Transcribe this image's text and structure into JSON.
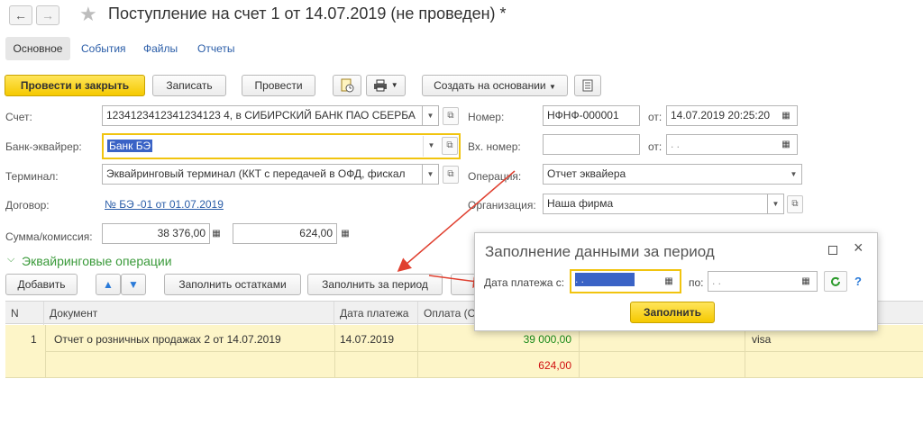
{
  "window": {
    "title": "Поступление на счет 1 от 14.07.2019 (не проведен) *"
  },
  "tabs": {
    "main": "Основное",
    "events": "События",
    "files": "Файлы",
    "reports": "Отчеты"
  },
  "toolbar": {
    "post_close": "Провести и закрыть",
    "save": "Записать",
    "post": "Провести",
    "create_based": "Создать на основании"
  },
  "form": {
    "account_label": "Счет:",
    "account_value": "1234123412341234123 4, в СИБИРСКИЙ БАНК ПАО СБЕРБА",
    "acquirer_label": "Банк-эквайрер:",
    "acquirer_value": "Банк БЭ",
    "terminal_label": "Терминал:",
    "terminal_value": "Эквайринговый терминал  (ККТ с передачей в ОФД, фискал",
    "contract_label": "Договор:",
    "contract_value": "№ БЭ -01 от 01.07.2019",
    "sum_label": "Сумма/комиссия:",
    "sum_value": "38 376,00",
    "commission_value": "624,00",
    "number_label": "Номер:",
    "number_value": "НФНФ-000001",
    "from_label": "от:",
    "date_value": "14.07.2019 20:25:20",
    "in_number_label": "Вх. номер:",
    "in_number_value": "",
    "in_date_value": " .  .",
    "operation_label": "Операция:",
    "operation_value": "Отчет эквайера",
    "org_label": "Организация:",
    "org_value": "Наша фирма"
  },
  "section": {
    "title": "Эквайринговые операции",
    "add": "Добавить",
    "fill_remains": "Заполнить остатками",
    "fill_period": "Заполнить за период"
  },
  "table": {
    "headers": [
      "N",
      "Документ",
      "Дата платежа",
      "Оплата (С"
    ],
    "rows": [
      {
        "n": "1",
        "document": "Отчет о розничных продажах 2 от 14.07.2019",
        "date": "14.07.2019",
        "payment": "39 000,00",
        "commission": "624,00",
        "card": "visa"
      }
    ]
  },
  "popup": {
    "title": "Заполнение данными за период",
    "date_from_label": "Дата платежа с:",
    "date_from_value": " .  .",
    "to_label": "по:",
    "date_to_value": " .  .",
    "fill_button": "Заполнить",
    "help": "?"
  },
  "colors": {
    "accent_yellow": "#f5c900",
    "link_blue": "#2a5da8",
    "section_green": "#3a9a3a",
    "row_yellow": "#fdf5c8",
    "arrow_red": "#e04030"
  }
}
